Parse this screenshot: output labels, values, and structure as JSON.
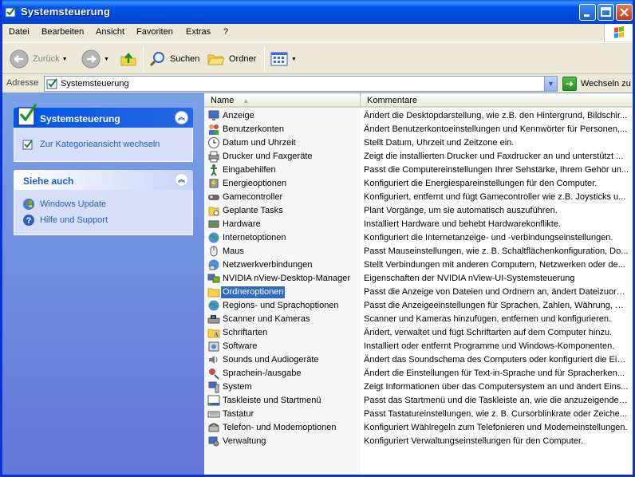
{
  "window": {
    "title": "Systemsteuerung"
  },
  "menu": [
    "Datei",
    "Bearbeiten",
    "Ansicht",
    "Favoriten",
    "Extras",
    "?"
  ],
  "toolbar": {
    "back": "Zurück",
    "search": "Suchen",
    "folders": "Ordner"
  },
  "address": {
    "label": "Adresse",
    "value": "Systemsteuerung",
    "go": "Wechseln zu"
  },
  "sidebar": {
    "panel1": {
      "title": "Systemsteuerung",
      "link": "Zur Kategorieansicht wechseln"
    },
    "panel2": {
      "title": "Siehe auch",
      "links": [
        "Windows Update",
        "Hilfe und Support"
      ]
    }
  },
  "list": {
    "columns": {
      "name": "Name",
      "comment": "Kommentare"
    },
    "items": [
      {
        "name": "Anzeige",
        "comment": "Ändert die Desktopdarstellung, wie z.B. den Hintergrund, Bildschir..."
      },
      {
        "name": "Benutzerkonten",
        "comment": "Ändert Benutzerkontoeinstellungen und Kennwörter für Personen,..."
      },
      {
        "name": "Datum und Uhrzeit",
        "comment": "Stellt Datum, Uhrzeit und Zeitzone ein."
      },
      {
        "name": "Drucker und Faxgeräte",
        "comment": "Zeigt die installierten Drucker und Faxdrucker an und unterstützt ..."
      },
      {
        "name": "Eingabehilfen",
        "comment": "Passt die Computereinstellungen Ihrer Sehstärke, Ihrem Gehör un..."
      },
      {
        "name": "Energieoptionen",
        "comment": "Konfiguriert die Energiespareinstellungen für den Computer."
      },
      {
        "name": "Gamecontroller",
        "comment": "Konfiguriert, entfernt und fügt Gamecontroller wie z.B. Joysticks u..."
      },
      {
        "name": "Geplante Tasks",
        "comment": "Plant Vorgänge, um sie automatisch auszuführen."
      },
      {
        "name": "Hardware",
        "comment": "Installiert Hardware und behebt Hardwarekonflikte."
      },
      {
        "name": "Internetoptionen",
        "comment": "Konfiguriert die Internetanzeige- und -verbindungseinstellungen."
      },
      {
        "name": "Maus",
        "comment": "Passt Mauseinstellungen, wie z. B. Schaltflächenkonfiguration, Do..."
      },
      {
        "name": "Netzwerkverbindungen",
        "comment": "Stellt Verbindungen mit anderen Computern, Netzwerken oder de..."
      },
      {
        "name": "NVIDIA nView-Desktop-Manager",
        "comment": "Eigenschaften der NVIDIA nView-UI-Systemsteuerung"
      },
      {
        "name": "Ordneroptionen",
        "comment": "Passt die Anzeige von Dateien und Ordnern an, ändert Dateizuord...",
        "selected": true
      },
      {
        "name": "Regions- und Sprachoptionen",
        "comment": "Passt die Anzeigeeinstellungen für Sprachen, Zahlen, Währung, D..."
      },
      {
        "name": "Scanner und Kameras",
        "comment": "Scanner und Kameras hinzufügen, entfernen und konfigurieren."
      },
      {
        "name": "Schriftarten",
        "comment": "Ändert, verwaltet und fügt Schriftarten auf dem Computer hinzu."
      },
      {
        "name": "Software",
        "comment": "Installiert oder entfernt Programme und Windows-Komponenten."
      },
      {
        "name": "Sounds und Audiogeräte",
        "comment": "Ändert das Soundschema des Computers oder konfiguriert die Ein..."
      },
      {
        "name": "Sprachein-/ausgabe",
        "comment": "Ändert die Einstellungen für Text-in-Sprache und für Spracherken..."
      },
      {
        "name": "System",
        "comment": "Zeigt Informationen über das Computersystem an und ändert Eins..."
      },
      {
        "name": "Taskleiste und Startmenü",
        "comment": "Passt das Startmenü und die Taskleiste an, wie die anzuzeigenden..."
      },
      {
        "name": "Tastatur",
        "comment": "Passt Tastatureinstellungen, wie z. B. Cursorblinkrate oder Zeiche..."
      },
      {
        "name": "Telefon- und Modemoptionen",
        "comment": "Konfiguriert Wählregeln zum Telefonieren und Modemeinstellungen."
      },
      {
        "name": "Verwaltung",
        "comment": "Konfiguriert Verwaltungseinstellungen für den Computer."
      }
    ]
  },
  "icons": [
    "monitor-icon",
    "users-icon",
    "clock-icon",
    "printer-icon",
    "accessibility-icon",
    "power-icon",
    "gamepad-icon",
    "tasks-icon",
    "hardware-icon",
    "globe-icon",
    "mouse-icon",
    "network-icon",
    "nview-icon",
    "folder-icon",
    "region-icon",
    "scanner-icon",
    "fonts-icon",
    "software-icon",
    "speaker-icon",
    "speech-icon",
    "system-icon",
    "taskbar-icon",
    "keyboard-icon",
    "phone-icon",
    "admin-icon"
  ]
}
